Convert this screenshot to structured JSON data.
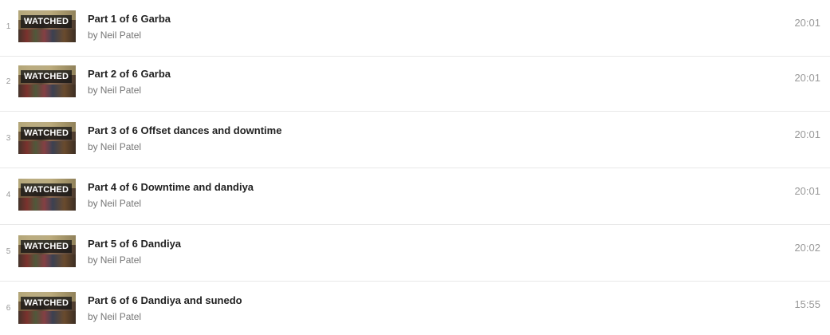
{
  "playlist": {
    "byline_prefix": "by",
    "items": [
      {
        "index": "1",
        "badge": "WATCHED",
        "title": "Part 1 of 6 Garba",
        "author": "Neil Patel",
        "duration": "20:01"
      },
      {
        "index": "2",
        "badge": "WATCHED",
        "title": "Part 2 of 6 Garba",
        "author": "Neil Patel",
        "duration": "20:01"
      },
      {
        "index": "3",
        "badge": "WATCHED",
        "title": "Part 3 of 6 Offset dances and downtime",
        "author": "Neil Patel",
        "duration": "20:01"
      },
      {
        "index": "4",
        "badge": "WATCHED",
        "title": "Part 4 of 6 Downtime and dandiya",
        "author": "Neil Patel",
        "duration": "20:01"
      },
      {
        "index": "5",
        "badge": "WATCHED",
        "title": "Part 5 of 6 Dandiya",
        "author": "Neil Patel",
        "duration": "20:02"
      },
      {
        "index": "6",
        "badge": "WATCHED",
        "title": "Part 6 of 6 Dandiya and sunedo",
        "author": "Neil Patel",
        "duration": "15:55"
      }
    ]
  }
}
